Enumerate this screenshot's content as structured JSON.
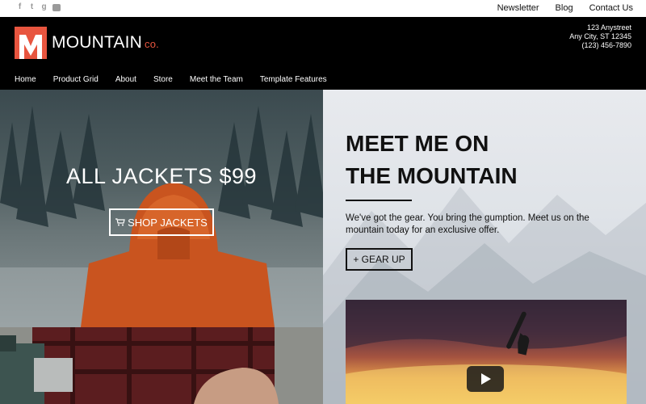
{
  "topbar": {
    "social": [
      "facebook-icon",
      "twitter-icon",
      "google-plus-icon",
      "youtube-icon"
    ],
    "links": [
      "Newsletter",
      "Blog",
      "Contact Us"
    ]
  },
  "brand": {
    "name": "MOUNTAIN",
    "suffix": "co.",
    "accent": "#e8553f"
  },
  "address": {
    "line1": "123 Anystreet",
    "line2": "Any City, ST 12345",
    "phone": "(123) 456-7890"
  },
  "nav": [
    "Home",
    "Product Grid",
    "About",
    "Store",
    "Meet the Team",
    "Template Features"
  ],
  "hero_left": {
    "title": "ALL JACKETS $99",
    "button": "SHOP JACKETS"
  },
  "hero_right": {
    "headline_line1": "MEET ME ON",
    "headline_line2": "THE MOUNTAIN",
    "body": "We've got the gear. You bring the gumption. Meet us on the mountain today for an exclusive offer.",
    "button": "+ GEAR UP"
  },
  "video": {
    "play_icon": "play-icon"
  }
}
